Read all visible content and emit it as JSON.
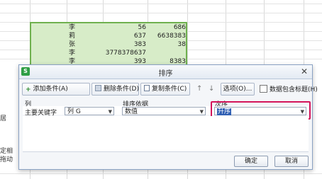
{
  "sheet": {
    "rows": [
      {
        "name": "李",
        "b": "56",
        "c": "686"
      },
      {
        "name": "莉",
        "b": "637",
        "c": "6638383"
      },
      {
        "name": "张",
        "b": "383",
        "c": "38"
      },
      {
        "name": "李",
        "b": "3778378637",
        "c": ""
      },
      {
        "name": "李",
        "b": "393",
        "c": "8383"
      }
    ],
    "left_text": {
      "t1": "居",
      "t2": "定相",
      "t3": "拖动"
    }
  },
  "dialog": {
    "title": "排序",
    "app_icon": "S",
    "toolbar": {
      "add": "添加条件(A)",
      "delete": "删除条件(D)",
      "copy": "复制条件(C)",
      "up": "↑",
      "down": "↓",
      "options": "选项(O)...",
      "header_checkbox": "数据包含标题(H)"
    },
    "headers": {
      "column": "列",
      "sort_by": "排序依据",
      "order": "次序"
    },
    "row": {
      "label": "主要关键字",
      "column_value": "列 G",
      "sort_by_value": "数值",
      "order_value": "升序"
    },
    "buttons": {
      "ok": "确定",
      "cancel": "取消"
    }
  },
  "colors": {
    "accent_highlight": "#d3145a",
    "selection_fill": "#d7ecc8",
    "selection_border": "#6fb04f"
  }
}
